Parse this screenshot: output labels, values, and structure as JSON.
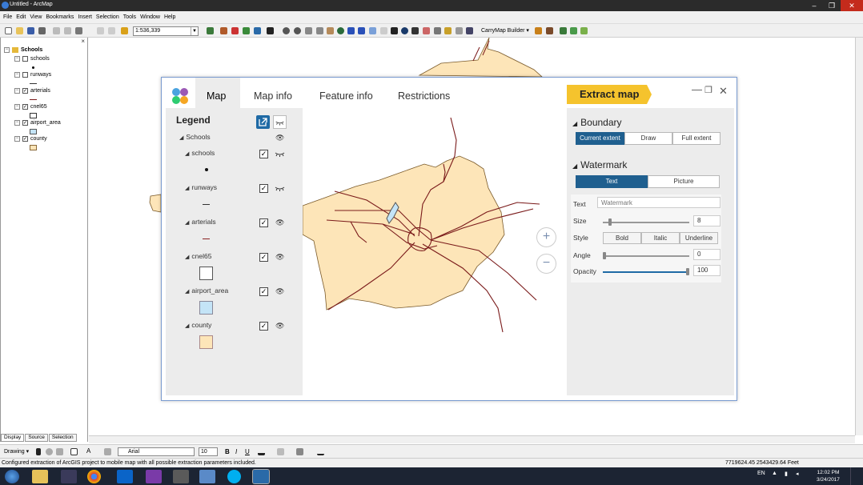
{
  "window": {
    "title": "Untitled - ArcMap"
  },
  "menu": [
    "File",
    "Edit",
    "View",
    "Bookmarks",
    "Insert",
    "Selection",
    "Tools",
    "Window",
    "Help"
  ],
  "toolbar": {
    "scale": "1:536,339",
    "carrymap_builder": "CarryMap Builder"
  },
  "toc": {
    "root": "Schools",
    "layers": [
      "schools",
      "runways",
      "arterials",
      "cnel65",
      "airport_area",
      "county"
    ],
    "tabs": [
      "Display",
      "Source",
      "Selection"
    ]
  },
  "drawing": {
    "label": "Drawing",
    "font": "Arial",
    "size": "10",
    "bold": "B",
    "italic": "I",
    "underline": "U"
  },
  "status": {
    "message": "Configured extraction of ArcGIS project to mobile map with all possible extraction parameters included.",
    "coords": "7719624.45  2543429.64 Feet"
  },
  "taskbar": {
    "lang": "EN",
    "time": "12:02 PM",
    "date": "3/24/2017"
  },
  "dialog": {
    "tabs": [
      "Map",
      "Map info",
      "Feature info",
      "Restrictions"
    ],
    "extract_label": "Extract map",
    "legend": {
      "title": "Legend",
      "root": "Schools",
      "layers": [
        {
          "name": "schools",
          "visibility": "hidden"
        },
        {
          "name": "runways",
          "visibility": "hidden"
        },
        {
          "name": "arterials",
          "visibility": "visible"
        },
        {
          "name": "cnel65",
          "visibility": "visible"
        },
        {
          "name": "airport_area",
          "visibility": "visible"
        },
        {
          "name": "county",
          "visibility": "visible"
        }
      ]
    },
    "boundary": {
      "title": "Boundary",
      "options": [
        "Current extent",
        "Draw",
        "Full extent"
      ],
      "selected": "Current extent"
    },
    "watermark": {
      "title": "Watermark",
      "modes": [
        "Text",
        "Picture"
      ],
      "selected_mode": "Text",
      "text_label": "Text",
      "text_placeholder": "Watermark",
      "size_label": "Size",
      "size_value": "8",
      "style_label": "Style",
      "styles": [
        "Bold",
        "Italic",
        "Underline"
      ],
      "angle_label": "Angle",
      "angle_value": "0",
      "opacity_label": "Opacity",
      "opacity_value": "100"
    }
  },
  "colors": {
    "county_fill": "#fde5b8",
    "roads": "#7a1a1a",
    "accent": "#1f5f8f",
    "extract": "#f5c32d",
    "airport_fill": "#c4e4f7"
  }
}
